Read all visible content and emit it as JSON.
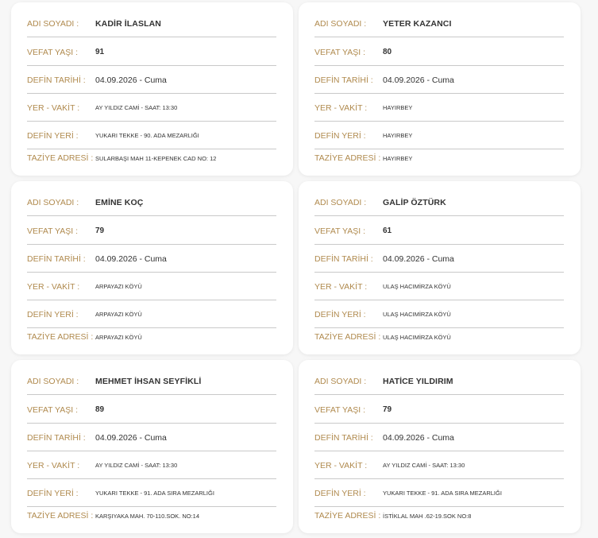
{
  "labels": {
    "name": "ADI SOYADI :",
    "age": "VEFAT YAŞI :",
    "date": "DEFİN TARİHİ :",
    "place_time": "YER - VAKİT :",
    "burial": "DEFİN YERİ :",
    "condolence": "TAZİYE ADRESİ :"
  },
  "cards": [
    {
      "name": "KADİR İLASLAN",
      "age": "91",
      "date": "04.09.2026 - Cuma",
      "place_time": "AY YILDIZ CAMİ - SAAT: 13:30",
      "burial": "YUKARI TEKKE - 90. ADA MEZARLIĞI",
      "condolence": "SULARBAŞI MAH 11-KEPENEK CAD NO: 12"
    },
    {
      "name": "YETER KAZANCI",
      "age": "80",
      "date": "04.09.2026 - Cuma",
      "place_time": "HAYIRBEY",
      "burial": "HAYIRBEY",
      "condolence": "HAYIRBEY"
    },
    {
      "name": "EMİNE KOÇ",
      "age": "79",
      "date": "04.09.2026 - Cuma",
      "place_time": "ARPAYAZI KÖYÜ",
      "burial": "ARPAYAZI KÖYÜ",
      "condolence": "ARPAYAZI KÖYÜ"
    },
    {
      "name": "GALİP ÖZTÜRK",
      "age": "61",
      "date": "04.09.2026 - Cuma",
      "place_time": "ULAŞ HACIMİRZA KÖYÜ",
      "burial": "ULAŞ HACIMİRZA KÖYÜ",
      "condolence": "ULAŞ HACIMİRZA KÖYÜ"
    },
    {
      "name": "MEHMET İHSAN SEYFİKLİ",
      "age": "89",
      "date": "04.09.2026 - Cuma",
      "place_time": "AY YILDIZ CAMİ - SAAT: 13:30",
      "burial": "YUKARI TEKKE - 91. ADA SIRA MEZARLIĞI",
      "condolence": "KARŞIYAKA MAH. 70-110.SOK. NO:14"
    },
    {
      "name": "HATİCE YILDIRIM",
      "age": "79",
      "date": "04.09.2026 - Cuma",
      "place_time": "AY YILDIZ CAMİ - SAAT: 13:30",
      "burial": "YUKARI TEKKE - 91. ADA SIRA MEZARLIĞI",
      "condolence": "İSTİKLAL MAH .62-19.SOK NO:8"
    }
  ]
}
